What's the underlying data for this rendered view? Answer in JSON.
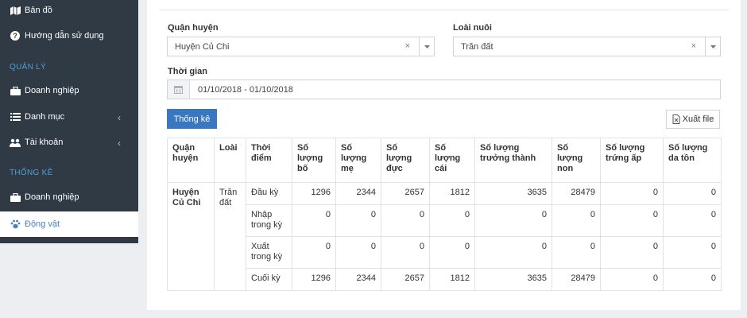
{
  "sidebar": {
    "items": {
      "map": {
        "label": "Bản đồ",
        "icon": "map-icon"
      },
      "help": {
        "label": "Hướng dẫn sử dụng",
        "icon": "question-circle-icon"
      },
      "manage_company": {
        "label": "Doanh nghiệp",
        "icon": "briefcase-icon"
      },
      "catalog": {
        "label": "Danh mục",
        "icon": "list-icon"
      },
      "accounts": {
        "label": "Tài khoản",
        "icon": "users-icon"
      },
      "stats_company": {
        "label": "Doanh nghiệp",
        "icon": "briefcase-icon"
      },
      "animals": {
        "label": "Động vật",
        "icon": "paw-icon"
      }
    },
    "sections": {
      "manage": "QUẢN LÝ",
      "stats": "THỐNG KÊ"
    },
    "active_item": "animals"
  },
  "filters": {
    "district_label": "Quận huyện",
    "district_value": "Huyện Củ Chi",
    "type_label": "Loài nuôi",
    "type_value": "Trăn đất",
    "time_label": "Thời gian",
    "time_value": "01/10/2018 - 01/10/2018"
  },
  "actions": {
    "stats_button": "Thống kê",
    "export_button": "Xuất file"
  },
  "table": {
    "headers": [
      "Quận huyện",
      "Loài",
      "Thời điểm",
      "Số lượng bố",
      "Số lượng mẹ",
      "Số lượng đực",
      "Số lượng cái",
      "Số lượng trưởng thành",
      "Số lượng non",
      "Số lượng trứng ấp",
      "Số lượng da tồn"
    ],
    "district": "Huyện Củ Chi",
    "species": "Trăn đất",
    "rows": [
      {
        "period": "Đầu kỳ",
        "values": [
          "1296",
          "2344",
          "2657",
          "1812",
          "3635",
          "28479",
          "0",
          "0"
        ]
      },
      {
        "period": "Nhập trong kỳ",
        "values": [
          "0",
          "0",
          "0",
          "0",
          "0",
          "0",
          "0",
          "0"
        ]
      },
      {
        "period": "Xuất trong kỳ",
        "values": [
          "0",
          "0",
          "0",
          "0",
          "0",
          "0",
          "0",
          "0"
        ]
      },
      {
        "period": "Cuối kỳ",
        "values": [
          "1296",
          "2344",
          "2657",
          "1812",
          "3635",
          "28479",
          "0",
          "0"
        ]
      }
    ]
  },
  "colors": {
    "sidebar_bg": "#2f3a45",
    "section_label": "#4f9fd7",
    "primary": "#3978c0",
    "active_text": "#4b7fbe"
  }
}
